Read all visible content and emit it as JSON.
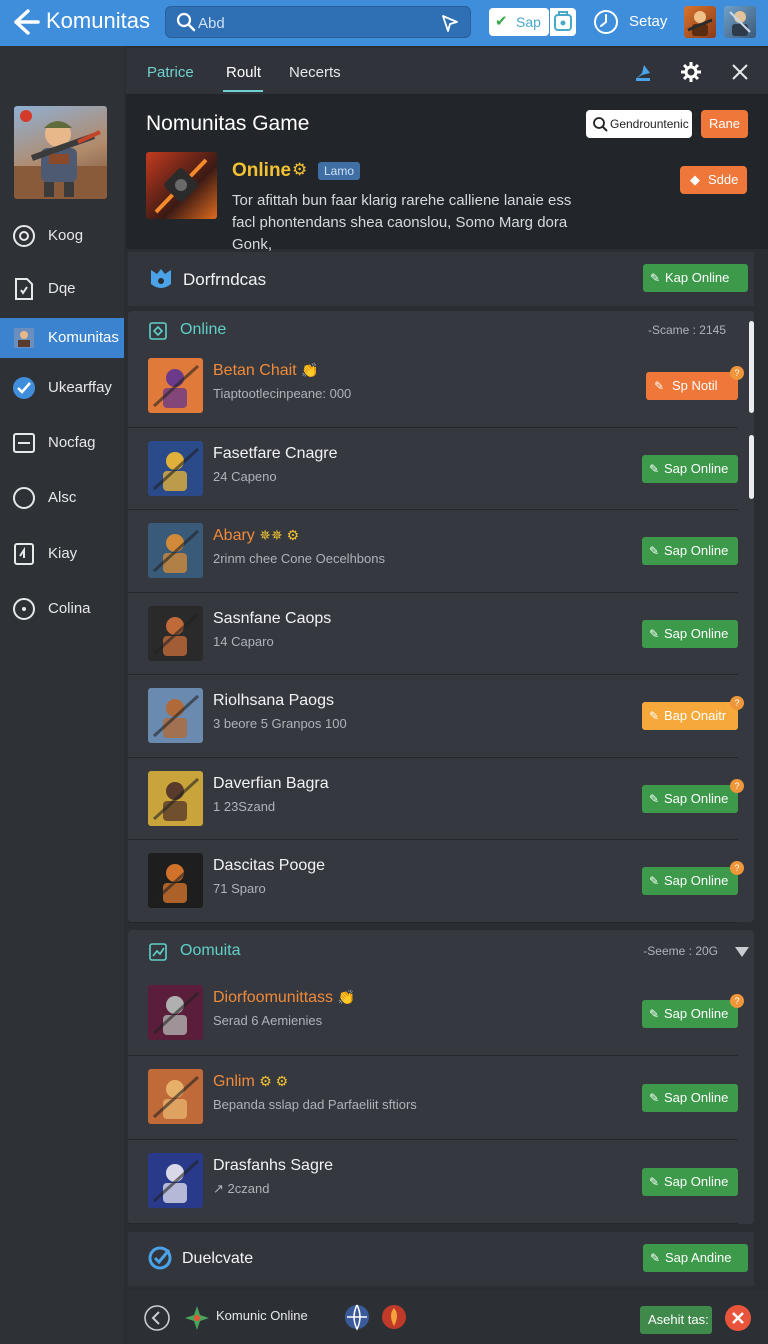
{
  "topbar": {
    "app_title": "Komunitas",
    "search_placeholder": "Abd",
    "save_label": "Sap",
    "user_name": "Setay",
    "accent_color": "#3f8edb"
  },
  "sidebar": {
    "items": [
      {
        "label": "Koog",
        "icon": "target-icon"
      },
      {
        "label": "Dqe",
        "icon": "document-icon"
      },
      {
        "label": "Komunitas",
        "icon": "community-icon",
        "active": true
      },
      {
        "label": "Ukearffay",
        "icon": "check-circle-icon"
      },
      {
        "label": "Nocfag",
        "icon": "square-minus-icon"
      },
      {
        "label": "Alsc",
        "icon": "circle-icon"
      },
      {
        "label": "Kiay",
        "icon": "card-icon"
      },
      {
        "label": "Colina",
        "icon": "dot-circle-icon"
      }
    ]
  },
  "tabs": {
    "items": [
      "Patrice",
      "Roult",
      "Necerts"
    ],
    "active_index": 1
  },
  "header": {
    "title": "Nomunitas Game",
    "search_label": "Gendrountenic",
    "rane_label": "Rane",
    "online_title": "Online",
    "badge": "Lamo",
    "description": "Tor afittah bun faar klarig rarehe calliene lanaie ess facl phontendans shea caonslou, Somo Marg dora Gonk,",
    "side_button": "Sdde"
  },
  "sections": {
    "dorfrndcas": {
      "title": "Dorfrndcas",
      "button": "Kap Online"
    },
    "online": {
      "title": "Online",
      "stat": "-Scame : 2145",
      "rows": [
        {
          "title": "Betan Chait",
          "subtitle": "Tiaptootlecinpeane: 000",
          "button": "Sp Notil",
          "button_style": "orange",
          "title_style": "orange",
          "emoji": "👏",
          "dot": "?"
        },
        {
          "title": "Fasetfare Cnagre",
          "subtitle": "24 Capeno",
          "button": "Sap Online",
          "button_style": "green",
          "title_style": "white",
          "emoji": "",
          "dot": ""
        },
        {
          "title": "Abary",
          "subtitle": "2rinm chee Cone Oecelhbons",
          "button": "Sap Online",
          "button_style": "green",
          "title_style": "orange",
          "emoji": "✵✵ ⚙",
          "dot": ""
        },
        {
          "title": "Sasnfane Caops",
          "subtitle": "14 Caparo",
          "button": "Sap Online",
          "button_style": "green",
          "title_style": "white",
          "emoji": "",
          "dot": ""
        },
        {
          "title": "Riolhsana Paogs",
          "subtitle": "3 beore 5 Granpos 100",
          "button": "Bap Onaitr",
          "button_style": "yellow",
          "title_style": "white",
          "emoji": "",
          "dot": "?"
        },
        {
          "title": "Daverfian Bagra",
          "subtitle": "1 23Szand",
          "button": "Sap Online",
          "button_style": "green",
          "title_style": "white",
          "emoji": "",
          "dot": "?"
        },
        {
          "title": "Dascitas Pooge",
          "subtitle": "71 Sparo",
          "button": "Sap Online",
          "button_style": "green",
          "title_style": "white",
          "emoji": "",
          "dot": "?"
        }
      ]
    },
    "oomuita": {
      "title": "Oomuita",
      "stat": "-Seeme : 20G",
      "rows": [
        {
          "title": "Diorfoomunittass",
          "subtitle": "Serad 6 Aemienies",
          "button": "Sap Online",
          "button_style": "green",
          "title_style": "orange",
          "emoji": "👏",
          "dot": "?"
        },
        {
          "title": "Gnlim",
          "subtitle": "Bepanda sslap dad Parfaeliit sftiors",
          "button": "Sap Online",
          "button_style": "green",
          "title_style": "orange",
          "emoji": "⚙ ⚙",
          "dot": ""
        },
        {
          "title": "Drasfanhs Sagre",
          "subtitle": "↗ 2czand",
          "button": "Sap Online",
          "button_style": "green",
          "title_style": "white",
          "emoji": "",
          "dot": ""
        }
      ]
    },
    "duelcvate": {
      "title": "Duelcvate",
      "button": "Sap Andine"
    }
  },
  "footer": {
    "label": "Komunic Online",
    "right_button": "Asehit tas:"
  }
}
